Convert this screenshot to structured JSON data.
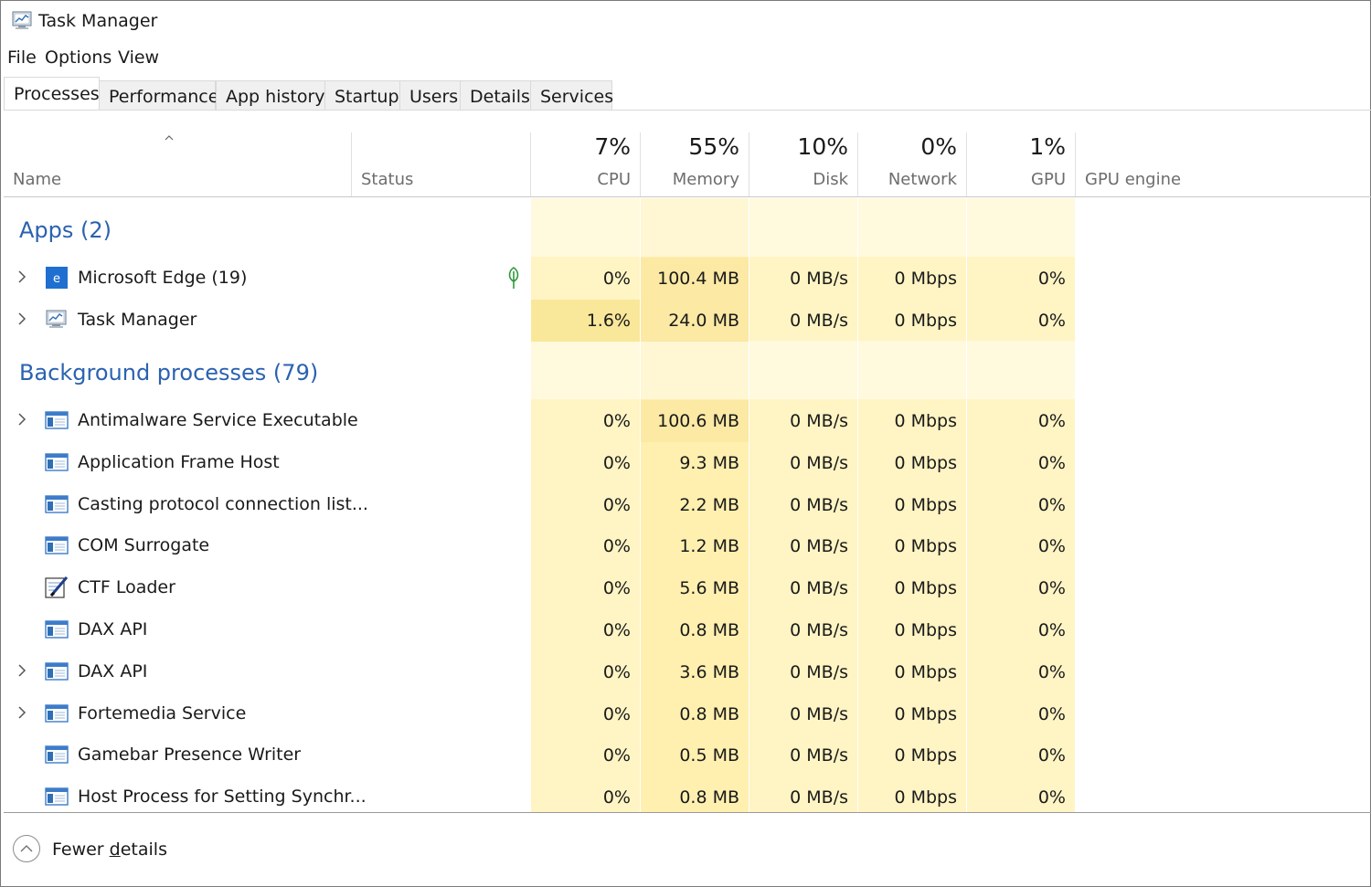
{
  "window": {
    "title": "Task Manager"
  },
  "menu": [
    "File",
    "Options",
    "View"
  ],
  "tabs": [
    {
      "label": "Processes",
      "active": true
    },
    {
      "label": "Performance"
    },
    {
      "label": "App history"
    },
    {
      "label": "Startup"
    },
    {
      "label": "Users"
    },
    {
      "label": "Details"
    },
    {
      "label": "Services"
    }
  ],
  "columns": {
    "name": {
      "label": "Name"
    },
    "status": {
      "label": "Status"
    },
    "cpu": {
      "percent": "7%",
      "label": "CPU"
    },
    "memory": {
      "percent": "55%",
      "label": "Memory"
    },
    "disk": {
      "percent": "10%",
      "label": "Disk"
    },
    "network": {
      "percent": "0%",
      "label": "Network"
    },
    "gpu": {
      "percent": "1%",
      "label": "GPU"
    },
    "gpu_engine": {
      "label": "GPU engine"
    }
  },
  "groups": {
    "apps": {
      "title": "Apps (2)"
    },
    "background": {
      "title": "Background processes (79)"
    }
  },
  "apps": [
    {
      "name": "Microsoft Edge (19)",
      "icon": "edge-icon",
      "expandable": true,
      "status_icon": "leaf-icon",
      "cpu": "0%",
      "memory": "100.4 MB",
      "disk": "0 MB/s",
      "network": "0 Mbps",
      "gpu": "0%"
    },
    {
      "name": "Task Manager",
      "icon": "task-manager-icon",
      "expandable": true,
      "cpu": "1.6%",
      "memory": "24.0 MB",
      "disk": "0 MB/s",
      "network": "0 Mbps",
      "gpu": "0%"
    }
  ],
  "background": [
    {
      "name": "Antimalware Service Executable",
      "icon": "service-window-icon",
      "expandable": true,
      "cpu": "0%",
      "memory": "100.6 MB",
      "disk": "0 MB/s",
      "network": "0 Mbps",
      "gpu": "0%"
    },
    {
      "name": "Application Frame Host",
      "icon": "service-window-icon",
      "cpu": "0%",
      "memory": "9.3 MB",
      "disk": "0 MB/s",
      "network": "0 Mbps",
      "gpu": "0%"
    },
    {
      "name": "Casting protocol connection list...",
      "icon": "service-window-icon",
      "cpu": "0%",
      "memory": "2.2 MB",
      "disk": "0 MB/s",
      "network": "0 Mbps",
      "gpu": "0%"
    },
    {
      "name": "COM Surrogate",
      "icon": "service-window-icon",
      "cpu": "0%",
      "memory": "1.2 MB",
      "disk": "0 MB/s",
      "network": "0 Mbps",
      "gpu": "0%"
    },
    {
      "name": "CTF Loader",
      "icon": "notepad-pen-icon",
      "cpu": "0%",
      "memory": "5.6 MB",
      "disk": "0 MB/s",
      "network": "0 Mbps",
      "gpu": "0%"
    },
    {
      "name": "DAX API",
      "icon": "service-window-icon",
      "cpu": "0%",
      "memory": "0.8 MB",
      "disk": "0 MB/s",
      "network": "0 Mbps",
      "gpu": "0%"
    },
    {
      "name": "DAX API",
      "icon": "service-window-icon",
      "expandable": true,
      "cpu": "0%",
      "memory": "3.6 MB",
      "disk": "0 MB/s",
      "network": "0 Mbps",
      "gpu": "0%"
    },
    {
      "name": "Fortemedia Service",
      "icon": "service-window-icon",
      "expandable": true,
      "cpu": "0%",
      "memory": "0.8 MB",
      "disk": "0 MB/s",
      "network": "0 Mbps",
      "gpu": "0%"
    },
    {
      "name": "Gamebar Presence Writer",
      "icon": "service-window-icon",
      "cpu": "0%",
      "memory": "0.5 MB",
      "disk": "0 MB/s",
      "network": "0 Mbps",
      "gpu": "0%"
    },
    {
      "name": "Host Process for Setting Synchr...",
      "icon": "service-window-icon",
      "cpu": "0%",
      "memory": "0.8 MB",
      "disk": "0 MB/s",
      "network": "0 Mbps",
      "gpu": "0%"
    }
  ],
  "footer": {
    "label": "Fewer details"
  },
  "colors": {
    "heat_light": "#fff4c4",
    "heat_medium": "#ffefa8",
    "heat_high": "#f9e79a",
    "group_title": "#2a62b0"
  }
}
